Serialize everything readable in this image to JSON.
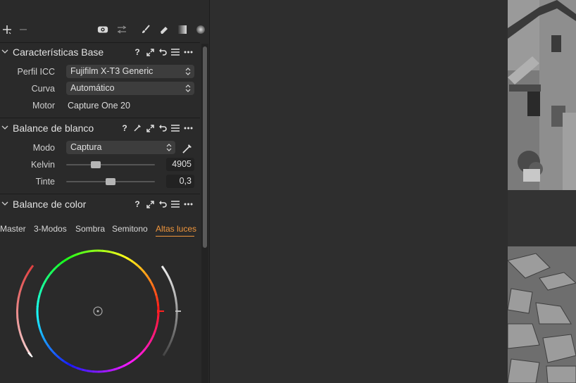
{
  "toolbar": {
    "add_icon": "plus-icon",
    "remove_icon": "minus-icon",
    "icons": [
      "eye-icon",
      "sliders-icon",
      "brush-icon",
      "eraser-icon",
      "gradient-icon",
      "radial-icon"
    ]
  },
  "sections": {
    "base": {
      "title": "Características Base",
      "rows": {
        "icc_label": "Perfil ICC",
        "icc_value": "Fujifilm X-T3 Generic",
        "curve_label": "Curva",
        "curve_value": "Automático",
        "engine_label": "Motor",
        "engine_value": "Capture One 20"
      }
    },
    "wb": {
      "title": "Balance de blanco",
      "mode_label": "Modo",
      "mode_value": "Captura",
      "kelvin_label": "Kelvin",
      "kelvin_value": "4905",
      "kelvin_fraction": 0.33,
      "tint_label": "Tinte",
      "tint_value": "0,3",
      "tint_fraction": 0.5
    },
    "color": {
      "title": "Balance de color",
      "tabs": [
        "Master",
        "3-Modos",
        "Sombra",
        "Semitono",
        "Altas luces"
      ],
      "active_tab": "Altas luces"
    }
  },
  "header_icons": {
    "help": "?",
    "expand": "expand-icon",
    "reset": "reset-icon",
    "presets": "list-icon",
    "more": "more-icon",
    "picker": "eyedropper-icon"
  },
  "colors": {
    "accent": "#f0963c",
    "panel_bg": "#2a2a2a",
    "control_bg": "#3d3d3d"
  }
}
